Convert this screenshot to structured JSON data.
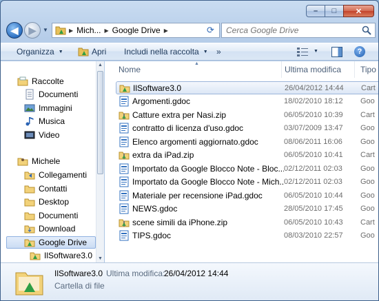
{
  "window": {
    "caption": {
      "minimize": "–",
      "maximize": "□",
      "close": "✕"
    }
  },
  "address": {
    "crumbs": [
      "Mich...",
      "Google Drive"
    ],
    "search_placeholder": "Cerca Google Drive"
  },
  "toolbar": {
    "organize": "Organizza",
    "open": "Apri",
    "include": "Includi nella raccolta",
    "more": "»"
  },
  "nav": {
    "libraries_header": "Raccolte",
    "libraries": [
      "Documenti",
      "Immagini",
      "Musica",
      "Video"
    ],
    "user_header": "Michele",
    "user_items": [
      "Collegamenti",
      "Contatti",
      "Desktop",
      "Documenti",
      "Download",
      "Google Drive",
      "IlSoftware3.0"
    ],
    "selected": "Google Drive"
  },
  "columns": {
    "name": "Nome",
    "modified": "Ultima modifica",
    "type": "Tipo"
  },
  "files": [
    {
      "name": "IlSoftware3.0",
      "date": "26/04/2012 14:44",
      "type": "Cart",
      "icon": "folder-drive-icon"
    },
    {
      "name": "Argomenti.gdoc",
      "date": "18/02/2010 18:12",
      "type": "Goo",
      "icon": "gdoc-icon"
    },
    {
      "name": "Catture extra per Nasi.zip",
      "date": "06/05/2010 10:39",
      "type": "Cart",
      "icon": "zip-icon"
    },
    {
      "name": "contratto di licenza d'uso.gdoc",
      "date": "03/07/2009 13:47",
      "type": "Goo",
      "icon": "gdoc-icon"
    },
    {
      "name": "Elenco argomenti aggiornato.gdoc",
      "date": "08/06/2011 16:06",
      "type": "Goo",
      "icon": "gdoc-icon"
    },
    {
      "name": "extra da iPad.zip",
      "date": "06/05/2010 10:41",
      "type": "Cart",
      "icon": "zip-icon"
    },
    {
      "name": "Importato da Google Blocco Note - Bloc...",
      "date": "02/12/2011 02:03",
      "type": "Goo",
      "icon": "gdoc-icon"
    },
    {
      "name": "Importato da Google Blocco Note - Mich...",
      "date": "02/12/2011 02:03",
      "type": "Goo",
      "icon": "gdoc-icon"
    },
    {
      "name": "Materiale per recensione iPad.gdoc",
      "date": "06/05/2010 10:44",
      "type": "Goo",
      "icon": "gdoc-icon"
    },
    {
      "name": "NEWS.gdoc",
      "date": "28/05/2010 17:45",
      "type": "Goo",
      "icon": "gdoc-icon"
    },
    {
      "name": "scene simili da iPhone.zip",
      "date": "06/05/2010 10:43",
      "type": "Cart",
      "icon": "zip-icon"
    },
    {
      "name": "TIPS.gdoc",
      "date": "08/03/2010 22:57",
      "type": "Goo",
      "icon": "gdoc-icon"
    }
  ],
  "details": {
    "name": "IlSoftware3.0",
    "modified_label": "Ultima modifica:",
    "modified_value": "26/04/2012 14:44",
    "type": "Cartella di file"
  }
}
